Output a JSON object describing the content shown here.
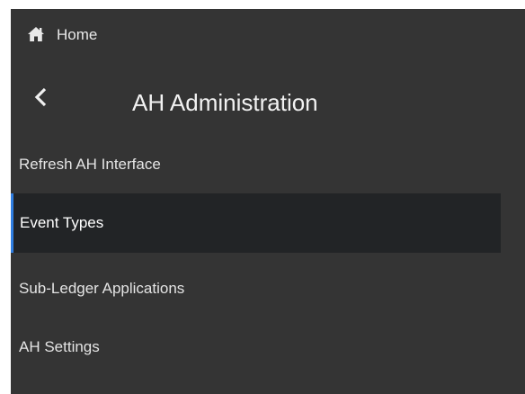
{
  "nav": {
    "home_label": "Home",
    "home_icon": "home-icon",
    "back_icon": "chevron-left-icon",
    "section_title": "AH Administration"
  },
  "menu": {
    "items": [
      {
        "label": "Refresh AH Interface",
        "active": false
      },
      {
        "label": "Event Types",
        "active": true
      },
      {
        "label": "Sub-Ledger Applications",
        "active": false
      },
      {
        "label": "AH Settings",
        "active": false
      }
    ]
  },
  "colors": {
    "panel_bg": "#343434",
    "active_bg": "#222426",
    "active_accent": "#2f7de0",
    "text": "#e4e4e4"
  }
}
